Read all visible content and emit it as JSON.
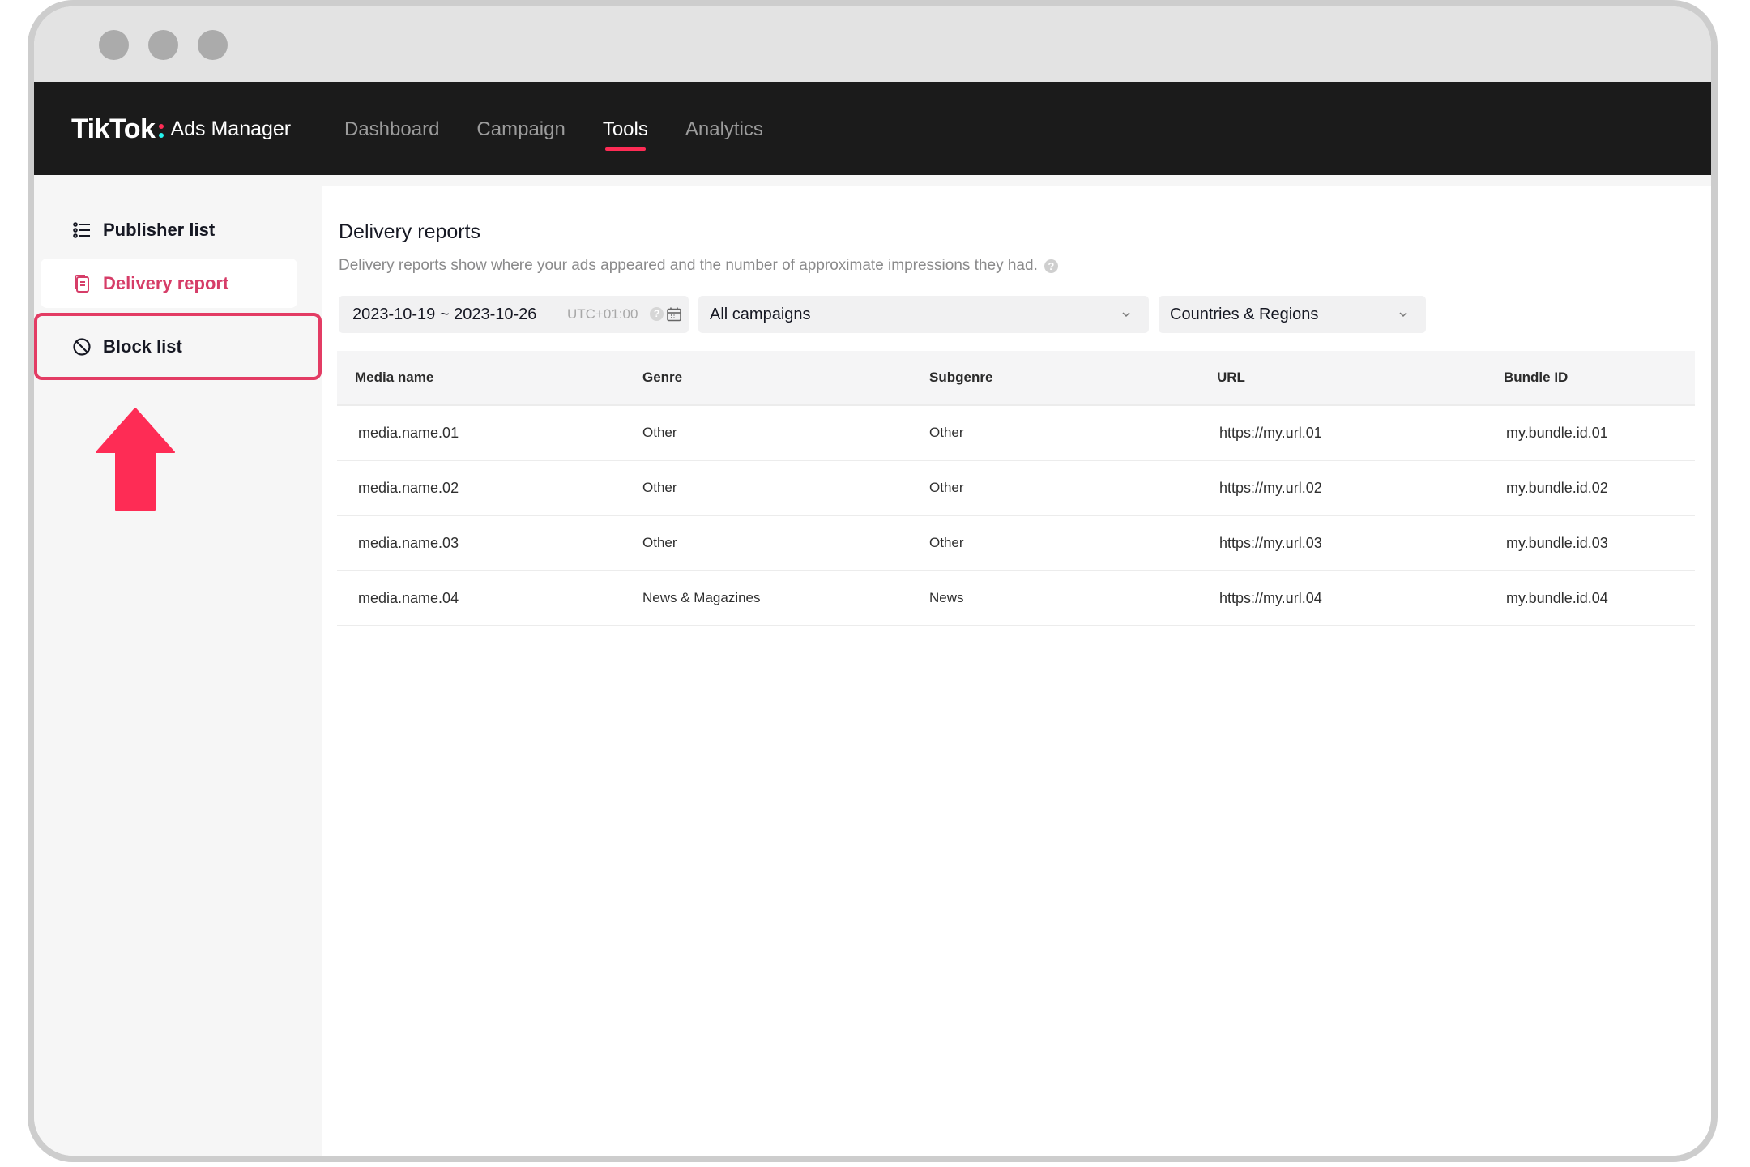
{
  "window": {
    "controls": [
      "close",
      "minimize",
      "maximize"
    ]
  },
  "header": {
    "logo_brand": "TikTok",
    "logo_product": "Ads Manager",
    "brand_colors": {
      "accent": "#fe2c55",
      "secondary": "#25f4ee"
    },
    "nav": [
      {
        "label": "Dashboard",
        "active": false
      },
      {
        "label": "Campaign",
        "active": false
      },
      {
        "label": "Tools",
        "active": true
      },
      {
        "label": "Analytics",
        "active": false
      }
    ]
  },
  "sidebar": {
    "items": [
      {
        "label": "Publisher list",
        "icon": "list-icon",
        "active": false
      },
      {
        "label": "Delivery report",
        "icon": "report-icon",
        "active": true
      },
      {
        "label": "Block list",
        "icon": "block-icon",
        "active": false,
        "highlighted": true
      }
    ]
  },
  "annotation": {
    "type": "up-arrow",
    "points_to": "Block list",
    "color": "#fe2c55"
  },
  "main": {
    "title": "Delivery reports",
    "description": "Delivery reports show where your ads appeared and the number of approximate impressions they had.",
    "filters": {
      "date_range": "2023-10-19 ~ 2023-10-26",
      "timezone": "UTC+01:00",
      "campaign": "All campaigns",
      "region": "Countries & Regions"
    },
    "table": {
      "columns": [
        "Media name",
        "Genre",
        "Subgenre",
        "URL",
        "Bundle ID"
      ],
      "rows": [
        [
          "media.name.01",
          "Other",
          "Other",
          "https://my.url.01",
          "my.bundle.id.01"
        ],
        [
          "media.name.02",
          "Other",
          "Other",
          "https://my.url.02",
          "my.bundle.id.02"
        ],
        [
          "media.name.03",
          "Other",
          "Other",
          "https://my.url.03",
          "my.bundle.id.03"
        ],
        [
          "media.name.04",
          "News & Magazines",
          "News",
          "https://my.url.04",
          "my.bundle.id.04"
        ]
      ]
    }
  }
}
